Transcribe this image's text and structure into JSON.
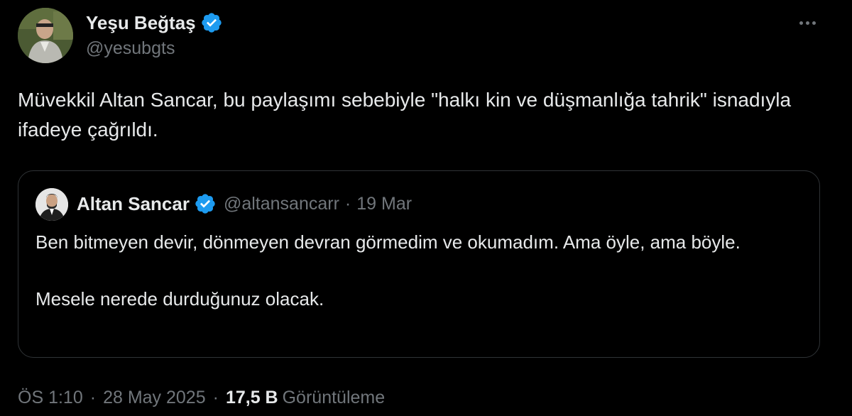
{
  "colors": {
    "background": "#000000",
    "text_primary": "#e7e9ea",
    "text_secondary": "#71767b",
    "border": "#2f3336",
    "verified": "#1d9bf0"
  },
  "author": {
    "display_name": "Yeşu Beğtaş",
    "handle": "@yesubgts",
    "verified": true,
    "avatar_icon": "person-photo-avatar"
  },
  "more_icon": "more-horizontal-icon",
  "tweet": {
    "text": "Müvekkil Altan Sancar, bu paylaşımı sebebiyle \"halkı kin ve düşmanlığa tahrik\" isnadıyla ifadeye çağrıldı."
  },
  "quote": {
    "display_name": "Altan Sancar",
    "handle": "@altansancarr",
    "separator": "·",
    "date": "19 Mar",
    "verified": true,
    "text": "Ben bitmeyen devir, dönmeyen devran görmedim ve okumadım. Ama öyle, ama böyle.\n\nMesele nerede durduğunuz olacak."
  },
  "meta": {
    "time": "ÖS 1:10",
    "separator": "·",
    "date": "28 May 2025",
    "views_count": "17,5 B",
    "views_label": "Görüntüleme"
  }
}
